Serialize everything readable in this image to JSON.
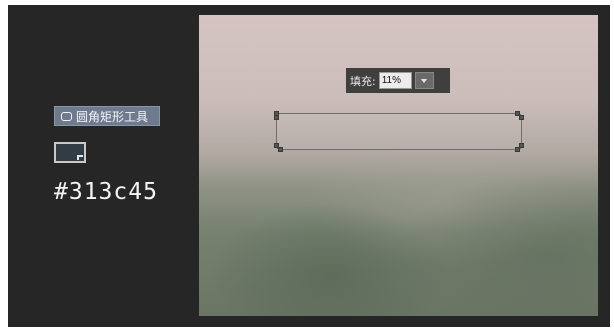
{
  "left_panel": {
    "tool_label": "圆角矩形工具",
    "tool_icon": "rounded-rectangle-icon",
    "swatch_color": "#313c45",
    "hex_text": "#313c45"
  },
  "options_bar": {
    "fill_label": "填充:",
    "fill_value": "11%",
    "dropdown_icon": "chevron-down-icon"
  }
}
